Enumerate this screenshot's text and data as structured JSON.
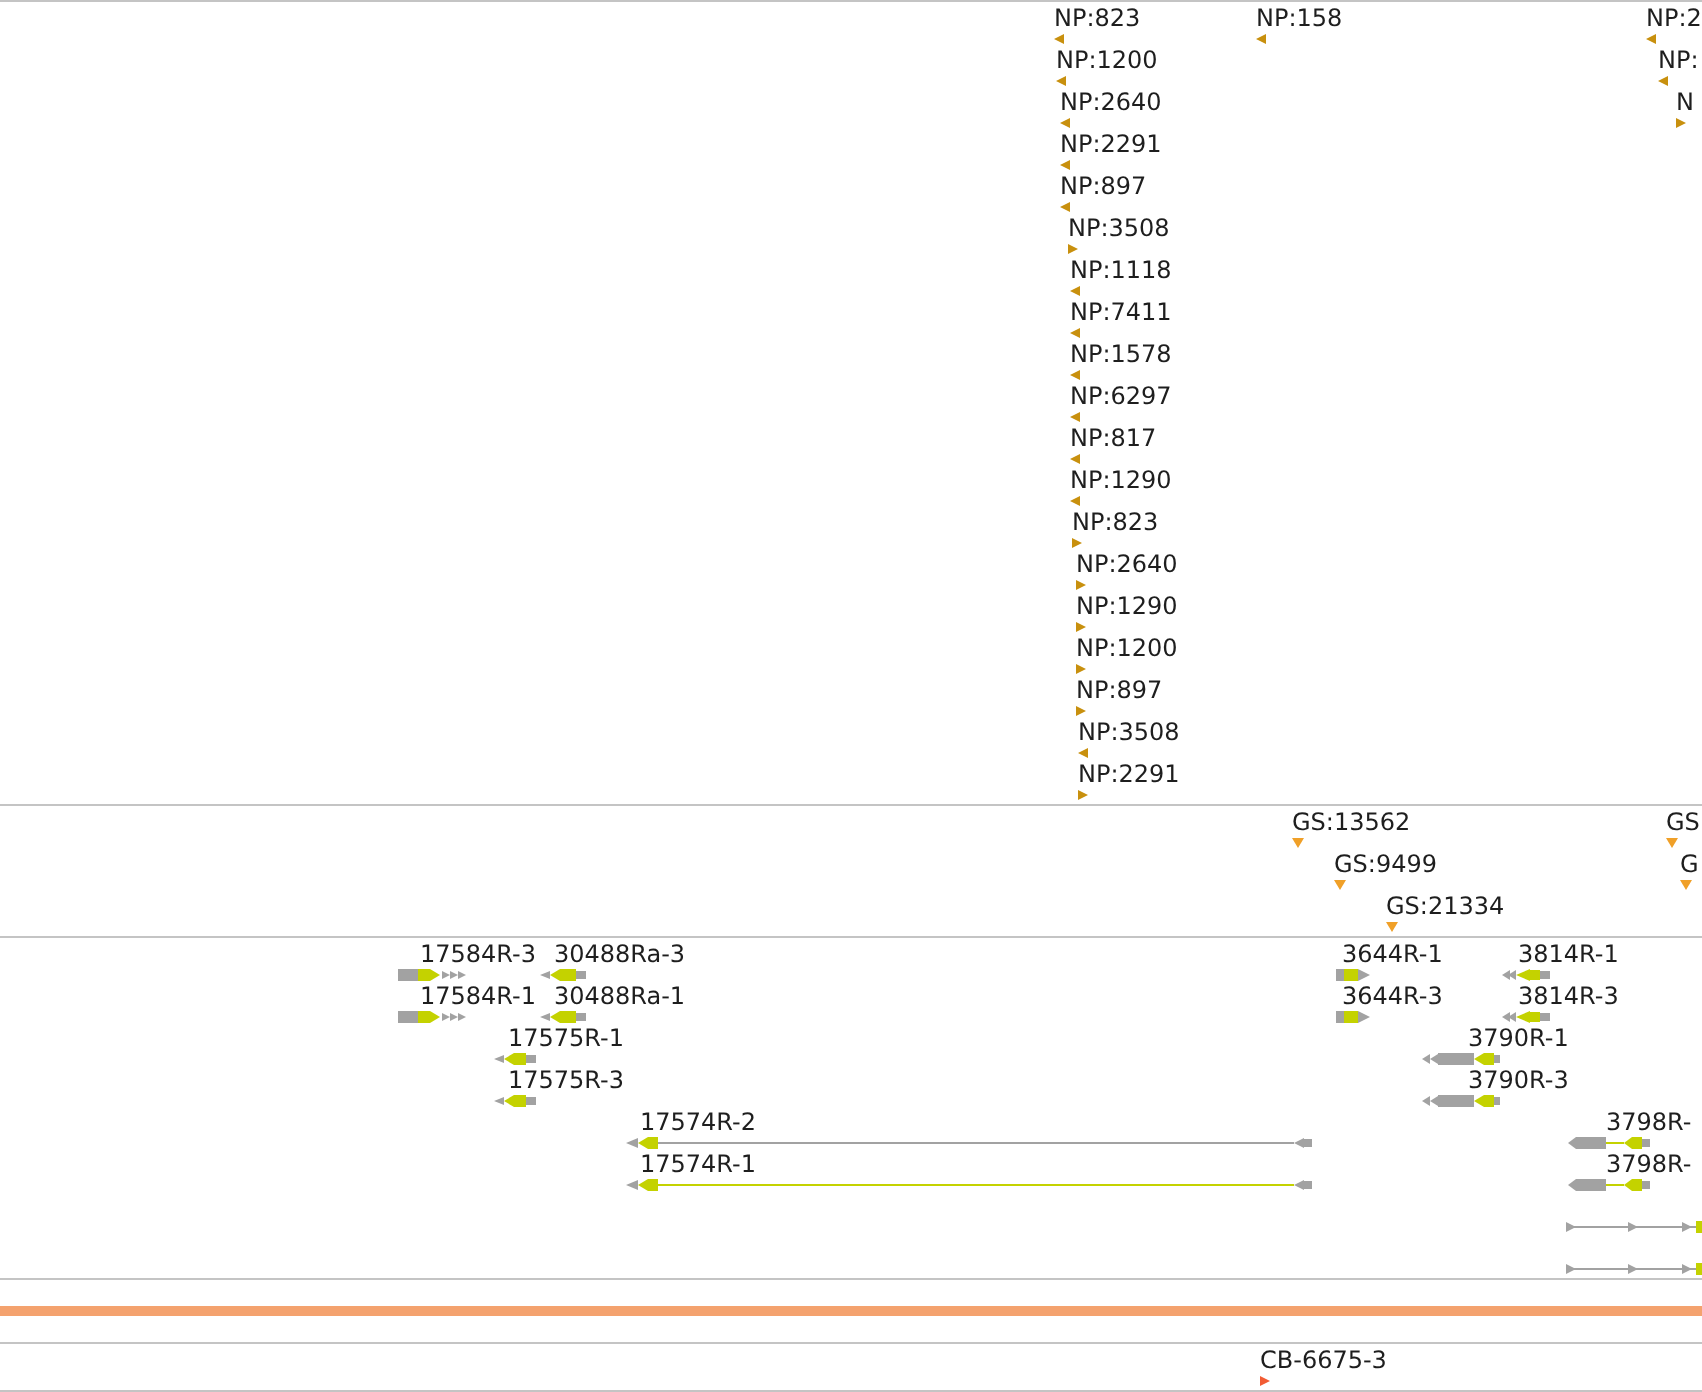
{
  "tracks": [
    {
      "kind": "labeled-markers",
      "color": "#c8900e",
      "features": [
        {
          "label": "NP:823",
          "reverse": true
        },
        {
          "label": "NP:158",
          "reverse": true
        },
        {
          "label": "NP:2",
          "reverse": true
        },
        {
          "label": "NP:1200",
          "reverse": true
        },
        {
          "label": "NP:",
          "reverse": true
        },
        {
          "label": "NP:2640",
          "reverse": true
        },
        {
          "label": "N",
          "reverse": false
        },
        {
          "label": "NP:2291",
          "reverse": true
        },
        {
          "label": "NP:897",
          "reverse": true
        },
        {
          "label": "NP:3508",
          "reverse": false
        },
        {
          "label": "NP:1118",
          "reverse": true
        },
        {
          "label": "NP:7411",
          "reverse": true
        },
        {
          "label": "NP:1578",
          "reverse": true
        },
        {
          "label": "NP:6297",
          "reverse": true
        },
        {
          "label": "NP:817",
          "reverse": true
        },
        {
          "label": "NP:1290",
          "reverse": true
        },
        {
          "label": "NP:823",
          "reverse": false
        },
        {
          "label": "NP:2640",
          "reverse": false
        },
        {
          "label": "NP:1290",
          "reverse": false
        },
        {
          "label": "NP:1200",
          "reverse": false
        },
        {
          "label": "NP:897",
          "reverse": false
        },
        {
          "label": "NP:3508",
          "reverse": true
        },
        {
          "label": "NP:2291",
          "reverse": false
        }
      ]
    },
    {
      "kind": "point-markers",
      "color": "#f0a028",
      "features": [
        {
          "label": "GS:13562"
        },
        {
          "label": "GS"
        },
        {
          "label": "GS:9499"
        },
        {
          "label": "G"
        },
        {
          "label": "GS:21334"
        }
      ]
    },
    {
      "kind": "gene-models",
      "features": [
        {
          "label": "17584R-3",
          "reverse": false
        },
        {
          "label": "30488Ra-3",
          "reverse": true
        },
        {
          "label": "3644R-1",
          "reverse": false
        },
        {
          "label": "3814R-1",
          "reverse": true
        },
        {
          "label": "17584R-1",
          "reverse": false
        },
        {
          "label": "30488Ra-1",
          "reverse": true
        },
        {
          "label": "3644R-3",
          "reverse": false
        },
        {
          "label": "3814R-3",
          "reverse": true
        },
        {
          "label": "17575R-1",
          "reverse": true
        },
        {
          "label": "3790R-1",
          "reverse": true
        },
        {
          "label": "17575R-3",
          "reverse": true
        },
        {
          "label": "3790R-3",
          "reverse": true
        },
        {
          "label": "17574R-2",
          "reverse": true
        },
        {
          "label": "3798R-",
          "reverse": true
        },
        {
          "label": "17574R-1",
          "reverse": true
        },
        {
          "label": "3798R-",
          "reverse": true
        },
        {
          "reverse": false
        },
        {
          "reverse": false
        }
      ]
    },
    {
      "kind": "coverage",
      "color": "#f4a26e"
    },
    {
      "kind": "labeled-markers",
      "color": "#f25c34",
      "features": [
        {
          "label": "CB-6675-3",
          "reverse": false
        }
      ]
    }
  ]
}
